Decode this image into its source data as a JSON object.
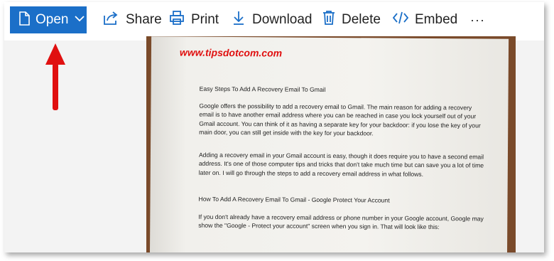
{
  "toolbar": {
    "open_label": "Open",
    "share_label": "Share",
    "print_label": "Print",
    "download_label": "Download",
    "delete_label": "Delete",
    "embed_label": "Embed",
    "more_label": "···"
  },
  "document": {
    "url": "www.tipsdotcom.com",
    "title": "Easy Steps To Add A Recovery Email To Gmail",
    "para1": "Google offers the possibility to add a recovery email to Gmail. The main reason for adding a recovery email is to have another email address where you can be reached in case you lock yourself out of your Gmail account. You can think of it as having a separate key for your backdoor: if you lose the key of your main door, you can still get inside with the key for your backdoor.",
    "para2": "Adding a recovery email in your Gmail account is easy, though it does require you to have a second email address. It's one of those computer tips and tricks that don't take much time but can save you a lot of time later on. I will go through the steps to add a recovery email address in what follows.",
    "heading2": "How To Add A Recovery Email To Gmail - Google Protect Your Account",
    "para3": "If you don't already have a recovery email address or phone number in your Google account, Google may show the \"Google - Protect your account\" screen when you sign in. That will look like this:"
  },
  "colors": {
    "accent": "#1b6fc8",
    "annotation_arrow": "#e01010",
    "url_text": "#e01010"
  }
}
